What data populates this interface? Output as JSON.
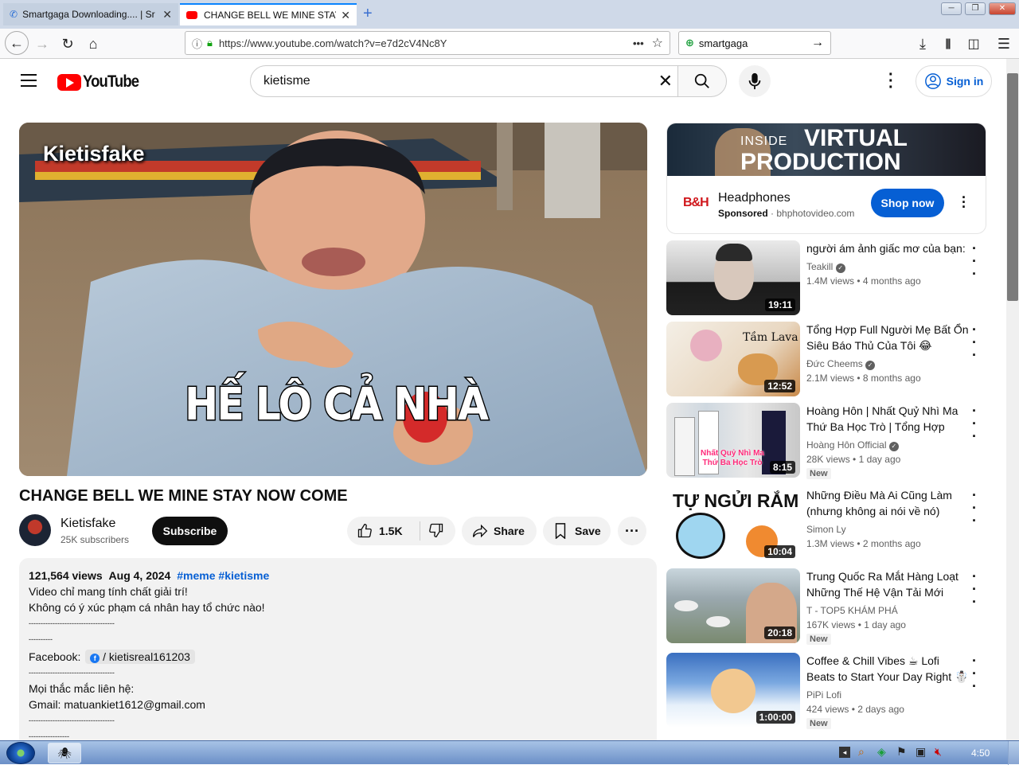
{
  "browser": {
    "tabs": [
      {
        "title": "Smartgaga Downloading.... | Sr"
      },
      {
        "title": "CHANGE BELL WE MINE STAY NO"
      }
    ],
    "url": "https://www.youtube.com/watch?v=e7d2cV4Nc8Y",
    "search_value": "smartgaga"
  },
  "youtube": {
    "logo_text": "YouTube",
    "search_value": "kietisme",
    "signin_label": "Sign in",
    "video": {
      "overlay_channel": "Kietisfake",
      "overlay_caption": "HẾ LÔ CẢ NHÀ",
      "title": "CHANGE BELL WE MINE STAY NOW COME",
      "channel": "Kietisfake",
      "subscribers": "25K subscribers",
      "subscribe_label": "Subscribe",
      "likes": "1.5K",
      "share_label": "Share",
      "save_label": "Save"
    },
    "description": {
      "views": "121,564 views",
      "date": "Aug 4, 2024",
      "tag1": "#meme",
      "tag2": "#kietisme",
      "line1": "Video chỉ mang tính chất giải trí!",
      "line2": "Không có ý xúc phạm cá nhân hay tổ chức nào!",
      "sep1": "------------------------------------",
      "sep2": "----------",
      "facebook_label": "Facebook:",
      "facebook_link": "/ kietisreal161203",
      "sep3": "------------------------------------",
      "contact": "Mọi thắc mắc liên hệ:",
      "gmail": "Gmail: matuankiet1612@gmail.com",
      "sep4": "------------------------------------",
      "sep5": "-----------------"
    },
    "ad": {
      "banner_line1": "INSIDE",
      "banner_line2": "VIRTUAL",
      "banner_line3": "PRODUCTION",
      "logo": "B&H",
      "title": "Headphones",
      "sponsored": "Sponsored",
      "domain": "bhphotovideo.com",
      "cta": "Shop now"
    },
    "recommendations": [
      {
        "title": "người ám ảnh giấc mơ của bạn:",
        "channel": "Teakill",
        "verified": true,
        "views": "1.4M views",
        "age": "4 months ago",
        "duration": "19:11",
        "new": ""
      },
      {
        "title": "Tổng Hợp Full Người Mẹ Bất Ổn Siêu Báo Thủ Của Tôi 😂",
        "channel": "Đức Cheems",
        "verified": true,
        "views": "2.1M views",
        "age": "8 months ago",
        "duration": "12:52",
        "new": "",
        "thumb_text": "Tầm Lava"
      },
      {
        "title": "Hoàng Hôn | Nhất Quỷ Nhì Ma Thứ Ba Học Trò | Tổng Hợp Clí...",
        "channel": "Hoàng Hôn Official",
        "verified": true,
        "views": "28K views",
        "age": "1 day ago",
        "duration": "8:15",
        "new": "New",
        "thumb_text": "Nhất Quỷ Nhì Ma Thứ Ba Học Trò"
      },
      {
        "title": "Những Điều Mà Ai Cũng Làm (nhưng không ai nói về nó)",
        "channel": "Simon Ly",
        "verified": false,
        "views": "1.3M views",
        "age": "2 months ago",
        "duration": "10:04",
        "new": "",
        "thumb_text": "TỰ NGỬI RẮM"
      },
      {
        "title": "Trung Quốc Ra Mắt Hàng Loạt Những Thế Hệ Vận Tải Mới Gâ...",
        "channel": "T - TOP5 KHÁM PHÁ",
        "verified": false,
        "views": "167K views",
        "age": "1 day ago",
        "duration": "20:18",
        "new": "New"
      },
      {
        "title": "Coffee & Chill Vibes ☕ Lofi Beats to Start Your Day Right ☃️",
        "channel": "PiPi Lofi",
        "verified": false,
        "views": "424 views",
        "age": "2 days ago",
        "duration": "1:00:00",
        "new": "New"
      }
    ]
  },
  "taskbar": {
    "clock": "4:50"
  }
}
